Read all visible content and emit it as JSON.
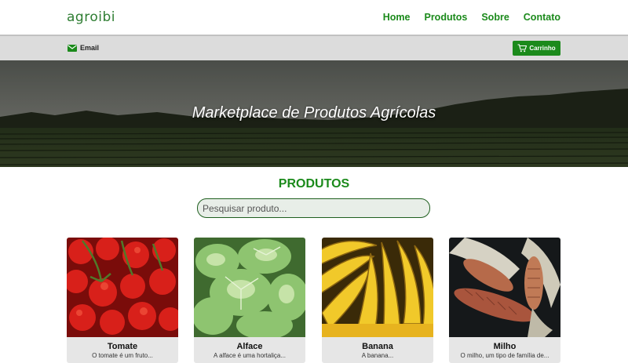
{
  "header": {
    "logo": "agroibi",
    "nav": [
      "Home",
      "Produtos",
      "Sobre",
      "Contato"
    ]
  },
  "subbar": {
    "email_label": "Email",
    "cart_label": "Carrinho"
  },
  "hero": {
    "title": "Marketplace de Produtos Agrícolas"
  },
  "products": {
    "title": "PRODUTOS",
    "search_placeholder": "Pesquisar produto...",
    "items": [
      {
        "name": "Tomate",
        "desc": "O tomate é um fruto..."
      },
      {
        "name": "Alface",
        "desc": "A alface é uma hortaliça..."
      },
      {
        "name": "Banana",
        "desc": "A banana..."
      },
      {
        "name": "Milho",
        "desc": "O milho, um tipo de família de..."
      }
    ]
  },
  "colors": {
    "brand_green": "#1b8a1b",
    "subbar_gray": "#dcdcdc"
  }
}
